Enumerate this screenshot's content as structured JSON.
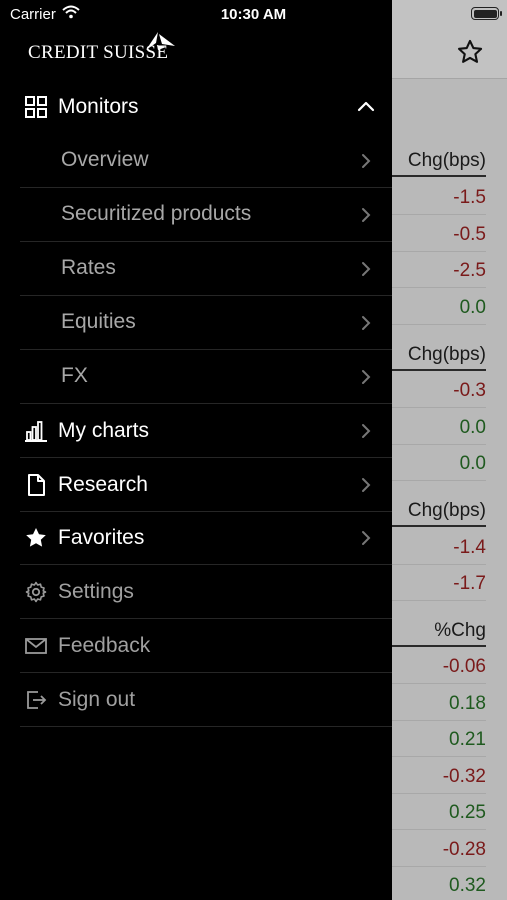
{
  "status_bar": {
    "carrier": "Carrier",
    "time": "10:30 AM"
  },
  "logo": {
    "text": "CREDIT SUISSE"
  },
  "menu": {
    "monitors_label": "Monitors",
    "submenu": [
      {
        "label": "Overview"
      },
      {
        "label": "Securitized products"
      },
      {
        "label": "Rates"
      },
      {
        "label": "Equities"
      },
      {
        "label": "FX"
      }
    ],
    "my_charts_label": "My charts",
    "research_label": "Research",
    "favorites_label": "Favorites",
    "settings_label": "Settings",
    "feedback_label": "Feedback",
    "sign_out_label": "Sign out"
  },
  "background": {
    "headers": [
      "Chg(bps)",
      "Chg(bps)",
      "Chg(bps)",
      "%Chg"
    ],
    "group1": [
      "-1.5",
      "-0.5",
      "-2.5",
      "0.0"
    ],
    "group2": [
      "-0.3",
      "0.0",
      "0.0"
    ],
    "group3": [
      "-1.4",
      "-1.7"
    ],
    "group4": [
      "-0.06",
      "0.18",
      "0.21",
      "-0.32",
      "0.25",
      "-0.28",
      "0.32"
    ]
  },
  "colors": {
    "negative": "#7a1a1a",
    "positive": "#1f5a1f"
  }
}
